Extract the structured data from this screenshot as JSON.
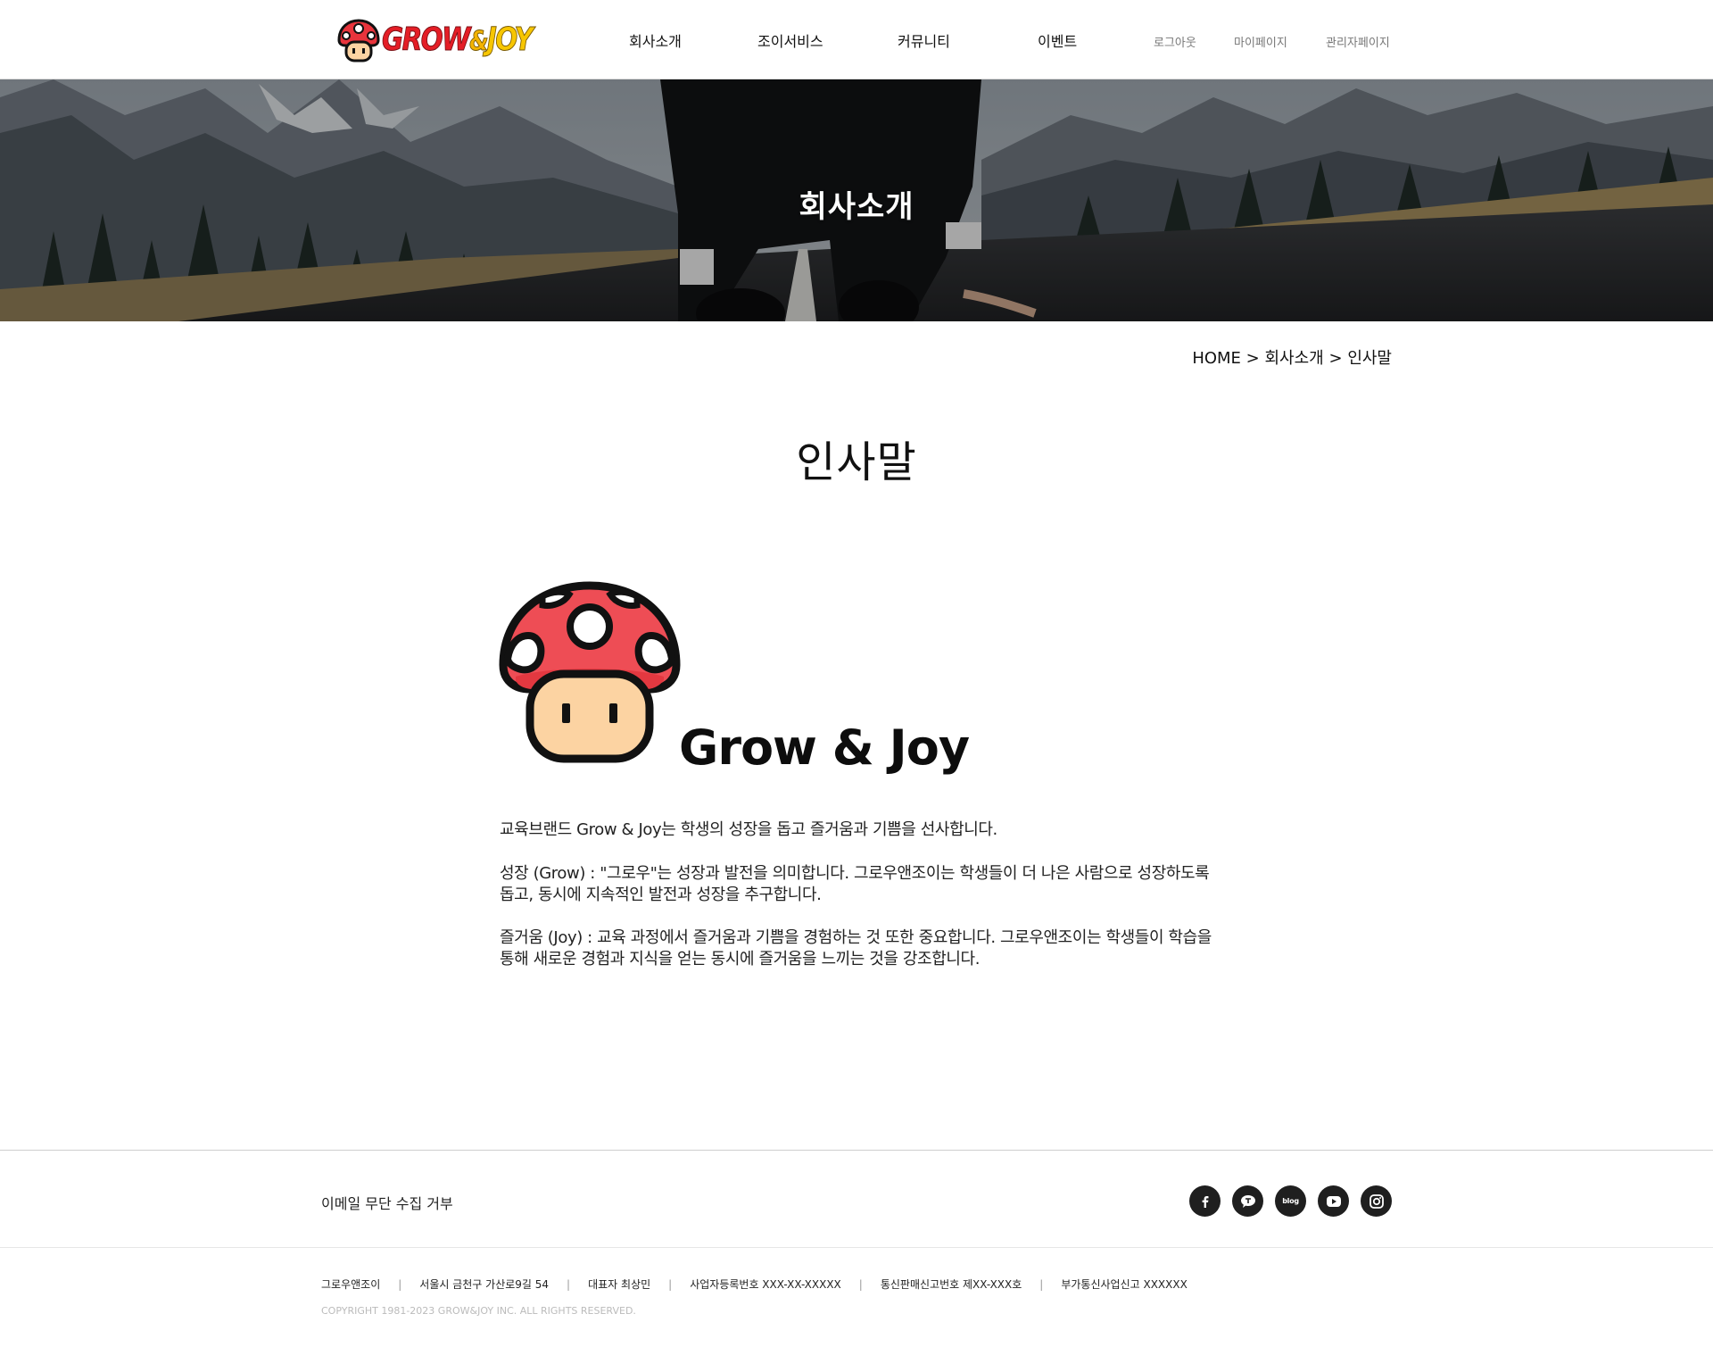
{
  "header": {
    "logo": {
      "part1": "GROW",
      "part2": "&",
      "part3": "JOY"
    },
    "nav": [
      "회사소개",
      "조이서비스",
      "커뮤니티",
      "이벤트"
    ],
    "util": [
      "로그아웃",
      "마이페이지",
      "관리자페이지"
    ]
  },
  "hero": {
    "title": "회사소개"
  },
  "breadcrumb": {
    "home": "HOME",
    "sep1": ">",
    "section": "회사소개",
    "sep2": ">",
    "current": "인사말"
  },
  "page": {
    "title": "인사말",
    "brand_name": "Grow & Joy",
    "paragraphs": [
      "교육브랜드 Grow & Joy는 학생의 성장을 돕고 즐거움과 기쁨을 선사합니다.",
      "성장 (Grow) : \"그로우\"는 성장과 발전을 의미합니다. 그로우앤조이는 학생들이 더 나은 사람으로 성장하도록 돕고, 동시에 지속적인 발전과 성장을 추구합니다.",
      "즐거움 (Joy) : 교육 과정에서 즐거움과 기쁨을 경험하는 것 또한 중요합니다. 그로우앤조이는 학생들이 학습을 통해 새로운 경험과 지식을 얻는 동시에 즐거움을 느끼는 것을 강조합니다."
    ]
  },
  "footer": {
    "email_policy": "이메일 무단 수집 거부",
    "sns": [
      {
        "name": "facebook",
        "icon": "facebook-icon"
      },
      {
        "name": "kakao",
        "icon": "kakao-icon"
      },
      {
        "name": "blog",
        "icon": "blog-icon",
        "label": "blog"
      },
      {
        "name": "youtube",
        "icon": "youtube-icon"
      },
      {
        "name": "instagram",
        "icon": "instagram-icon"
      }
    ],
    "info": {
      "company": "그로우앤조이",
      "address": "서울시 금천구 가산로9길 54",
      "ceo": "대표자 최상민",
      "biz_no": "사업자등록번호 XXX-XX-XXXXX",
      "mail_order": "통신판매신고번호 제XX-XXX호",
      "vat": "부가통신사업신고 XXXXXX",
      "separator": "|"
    },
    "copyright": "COPYRIGHT 1981-2023 GROW&JOY INC. ALL RIGHTS RESERVED."
  },
  "colors": {
    "logo_red": "#e41e26",
    "logo_yellow": "#f7c600",
    "mushroom_red": "#ee4d55",
    "mushroom_face": "#fcd3a2",
    "footer_icon_bg": "#1f1f1f"
  }
}
